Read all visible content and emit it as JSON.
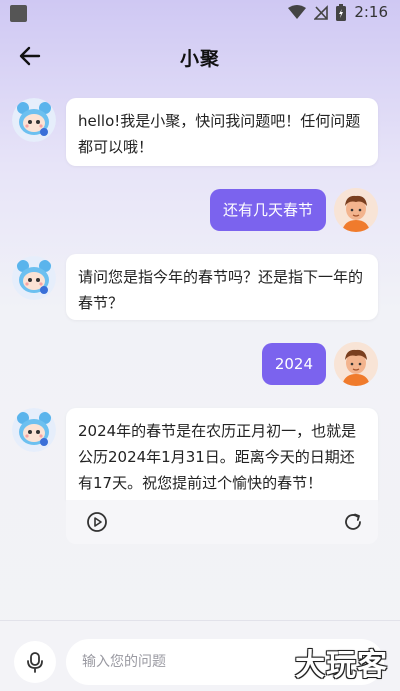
{
  "status_bar": {
    "time": "2:16"
  },
  "header": {
    "title": "小聚"
  },
  "messages": [
    {
      "role": "bot",
      "text": "hello!我是小聚，快问我问题吧！任何问题都可以哦！"
    },
    {
      "role": "user",
      "text": "还有几天春节"
    },
    {
      "role": "bot",
      "text": "请问您是指今年的春节吗？还是指下一年的春节？"
    },
    {
      "role": "user",
      "text": "2024"
    },
    {
      "role": "bot",
      "text": "2024年的春节是在农历正月初一，也就是公历2024年1月31日。距离今天的日期还有17天。祝您提前过个愉快的春节！"
    }
  ],
  "input": {
    "placeholder": "输入您的问题"
  },
  "watermark": "大玩客",
  "colors": {
    "accent": "#7b63ee",
    "bubble": "#ffffff",
    "background": "#f3f3f6"
  }
}
